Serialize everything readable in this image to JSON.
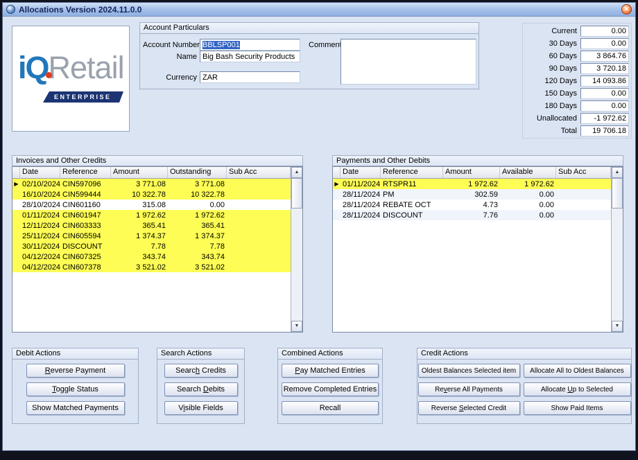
{
  "window": {
    "title": "Allocations Version 2024.11.0.0"
  },
  "icons": {
    "close": "✕",
    "row_marker": "▶",
    "scroll_up": "▲",
    "scroll_down": "▼"
  },
  "logo": {
    "iq": "iQ",
    "retail": "Retail",
    "banner": "ENTERPRISE"
  },
  "account_particulars": {
    "caption": "Account Particulars",
    "fields": {
      "account_number": {
        "label": "Account Number",
        "value": "BBLSP001"
      },
      "name": {
        "label": "Name",
        "value": "Big Bash Security Products"
      },
      "currency": {
        "label": "Currency",
        "value": "ZAR"
      },
      "comments": {
        "label": "Comments",
        "value": ""
      }
    }
  },
  "aging": {
    "rows": [
      {
        "label": "Current",
        "value": "0.00"
      },
      {
        "label": "30 Days",
        "value": "0.00"
      },
      {
        "label": "60 Days",
        "value": "3 864.76"
      },
      {
        "label": "90 Days",
        "value": "3 720.18"
      },
      {
        "label": "120 Days",
        "value": "14 093.86"
      },
      {
        "label": "150 Days",
        "value": "0.00"
      },
      {
        "label": "180 Days",
        "value": "0.00"
      },
      {
        "label": "Unallocated",
        "value": "-1 972.62"
      },
      {
        "label": "Total",
        "value": "19 706.18"
      }
    ]
  },
  "credits_grid": {
    "caption": "Invoices and Other Credits",
    "columns": [
      "Date",
      "Reference",
      "Amount",
      "Outstanding",
      "Sub Acc"
    ],
    "rows": [
      {
        "date": "02/10/2024",
        "reference": "CIN597096",
        "amount": "3 771.08",
        "outstanding": "3 771.08",
        "sub_acc": "",
        "matched": true,
        "current": true
      },
      {
        "date": "16/10/2024",
        "reference": "CIN599444",
        "amount": "10 322.78",
        "outstanding": "10 322.78",
        "sub_acc": "",
        "matched": true,
        "current": false
      },
      {
        "date": "28/10/2024",
        "reference": "CIN601160",
        "amount": "315.08",
        "outstanding": "0.00",
        "sub_acc": "",
        "matched": false,
        "current": false
      },
      {
        "date": "01/11/2024",
        "reference": "CIN601947",
        "amount": "1 972.62",
        "outstanding": "1 972.62",
        "sub_acc": "",
        "matched": true,
        "current": false
      },
      {
        "date": "12/11/2024",
        "reference": "CIN603333",
        "amount": "365.41",
        "outstanding": "365.41",
        "sub_acc": "",
        "matched": true,
        "current": false
      },
      {
        "date": "25/11/2024",
        "reference": "CIN605594",
        "amount": "1 374.37",
        "outstanding": "1 374.37",
        "sub_acc": "",
        "matched": true,
        "current": false
      },
      {
        "date": "30/11/2024",
        "reference": "DISCOUNT",
        "amount": "7.78",
        "outstanding": "7.78",
        "sub_acc": "",
        "matched": true,
        "current": false
      },
      {
        "date": "04/12/2024",
        "reference": "CIN607325",
        "amount": "343.74",
        "outstanding": "343.74",
        "sub_acc": "",
        "matched": true,
        "current": false
      },
      {
        "date": "04/12/2024",
        "reference": "CIN607378",
        "amount": "3 521.02",
        "outstanding": "3 521.02",
        "sub_acc": "",
        "matched": true,
        "current": false
      }
    ]
  },
  "debits_grid": {
    "caption": "Payments and Other Debits",
    "columns": [
      "Date",
      "Reference",
      "Amount",
      "Available",
      "Sub Acc"
    ],
    "rows": [
      {
        "date": "01/11/2024",
        "reference": "RTSPR11",
        "amount": "1 972.62",
        "available": "1 972.62",
        "sub_acc": "",
        "matched": true,
        "current": true
      },
      {
        "date": "28/11/2024",
        "reference": "PM",
        "amount": "302.59",
        "available": "0.00",
        "sub_acc": "",
        "matched": false,
        "current": false
      },
      {
        "date": "28/11/2024",
        "reference": "REBATE OCT",
        "amount": "4.73",
        "available": "0.00",
        "sub_acc": "",
        "matched": false,
        "current": false
      },
      {
        "date": "28/11/2024",
        "reference": "DISCOUNT",
        "amount": "7.76",
        "available": "0.00",
        "sub_acc": "",
        "matched": false,
        "current": false
      }
    ]
  },
  "action_groups": [
    {
      "caption": "Debit Actions",
      "buttons": [
        {
          "label": "Reverse Payment",
          "accel_index": 0
        },
        {
          "label": "Toggle Status",
          "accel_index": 0
        },
        {
          "label": "Show Matched Payments",
          "accel_index": -1
        }
      ]
    },
    {
      "caption": "Search Actions",
      "buttons": [
        {
          "label": "Search Credits",
          "accel_index": 5
        },
        {
          "label": "Search Debits",
          "accel_index": 7
        },
        {
          "label": "Visible Fields",
          "accel_index": 1
        }
      ]
    },
    {
      "caption": "Combined Actions",
      "buttons": [
        {
          "label": "Pay Matched Entries",
          "accel_index": 0
        },
        {
          "label": "Remove Completed Entries",
          "accel_index": -1
        },
        {
          "label": "Recall",
          "accel_index": -1
        }
      ]
    },
    {
      "caption": "Credit Actions",
      "buttons": [
        {
          "label": "Oldest Balances Selected item",
          "accel_index": -1
        },
        {
          "label": "Allocate All to Oldest Balances",
          "accel_index": -1
        },
        {
          "label": "Reverse All Payments",
          "accel_index": 2
        },
        {
          "label": "Allocate Up to Selected",
          "accel_index": 9
        },
        {
          "label": "Reverse Selected Credit",
          "accel_index": 8
        },
        {
          "label": "Show Paid Items",
          "accel_index": -1
        }
      ]
    }
  ]
}
